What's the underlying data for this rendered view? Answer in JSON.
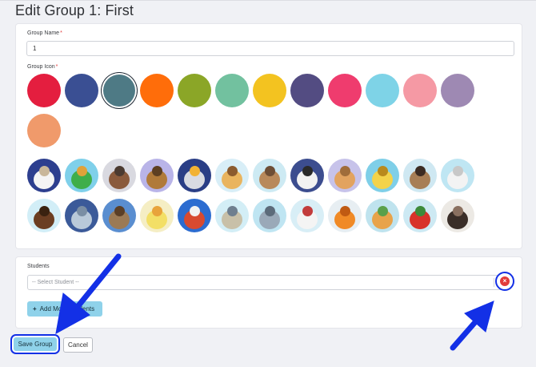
{
  "page_title": "Edit Group 1: First",
  "form": {
    "group_name_label": "Group Name",
    "group_name_value": "1",
    "required_mark": "*",
    "group_icon_label": "Group Icon",
    "icon_colors": [
      "#e41e3f",
      "#3a4f93",
      "#4e7a85",
      "#ff6d0a",
      "#8ba627",
      "#72c19f",
      "#f3c320",
      "#534c82",
      "#ef3c6e",
      "#7ed3e7",
      "#f599a4",
      "#9e89b3",
      "#f09a6b"
    ],
    "selected_color_index": 2
  },
  "animal_icons": [
    "dog-icon",
    "dragon-icon",
    "bird-nest-icon",
    "yorkie-icon",
    "robot-icon",
    "giraffe-icon",
    "terrier-icon",
    "zebra-icon",
    "kangaroo-icon",
    "horse-toy-icon",
    "pug-icon",
    "cat-icon",
    "horse-icon",
    "elephant-icon",
    "lion-icon",
    "duck-icon",
    "clown-dog-icon",
    "robot-toy-icon",
    "robot-dog-icon",
    "cartoon-dog-icon",
    "pumpkin-cat-icon",
    "farm-icon",
    "parrot-icon",
    "black-dog-icon"
  ],
  "students": {
    "label": "Students",
    "select_placeholder": "-- Select Student --",
    "chevron": "⌄",
    "remove_symbol": "×",
    "add_more_label": "Add More Students",
    "plus": "+"
  },
  "actions": {
    "save_label": "Save Group",
    "cancel_label": "Cancel"
  },
  "annotation_color": "#1330e6"
}
